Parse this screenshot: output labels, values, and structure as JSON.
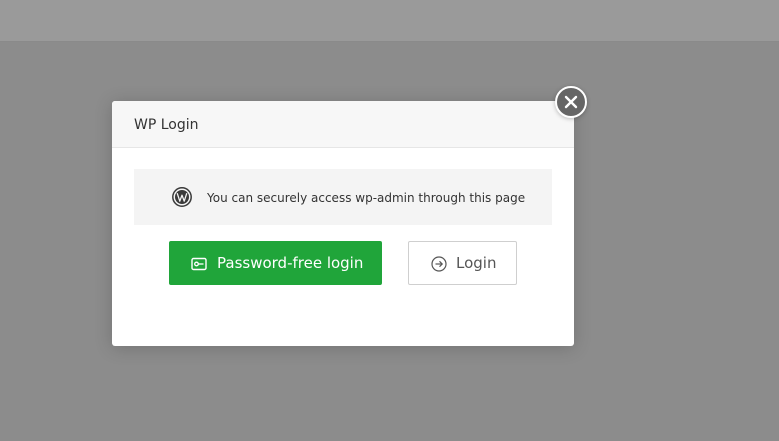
{
  "colors": {
    "overlay": "#8c8c8c",
    "primary": "#20a53a",
    "close_button": "#666666"
  },
  "dialog": {
    "title": "WP Login",
    "close_icon": "close-icon",
    "notice": {
      "icon": "wordpress-logo-icon",
      "text": "You can securely access wp-admin through this page"
    },
    "buttons": {
      "password_free_label": "Password-free login",
      "password_free_icon": "key-card-icon",
      "login_label": "Login",
      "login_icon": "arrow-right-circle-icon"
    }
  }
}
